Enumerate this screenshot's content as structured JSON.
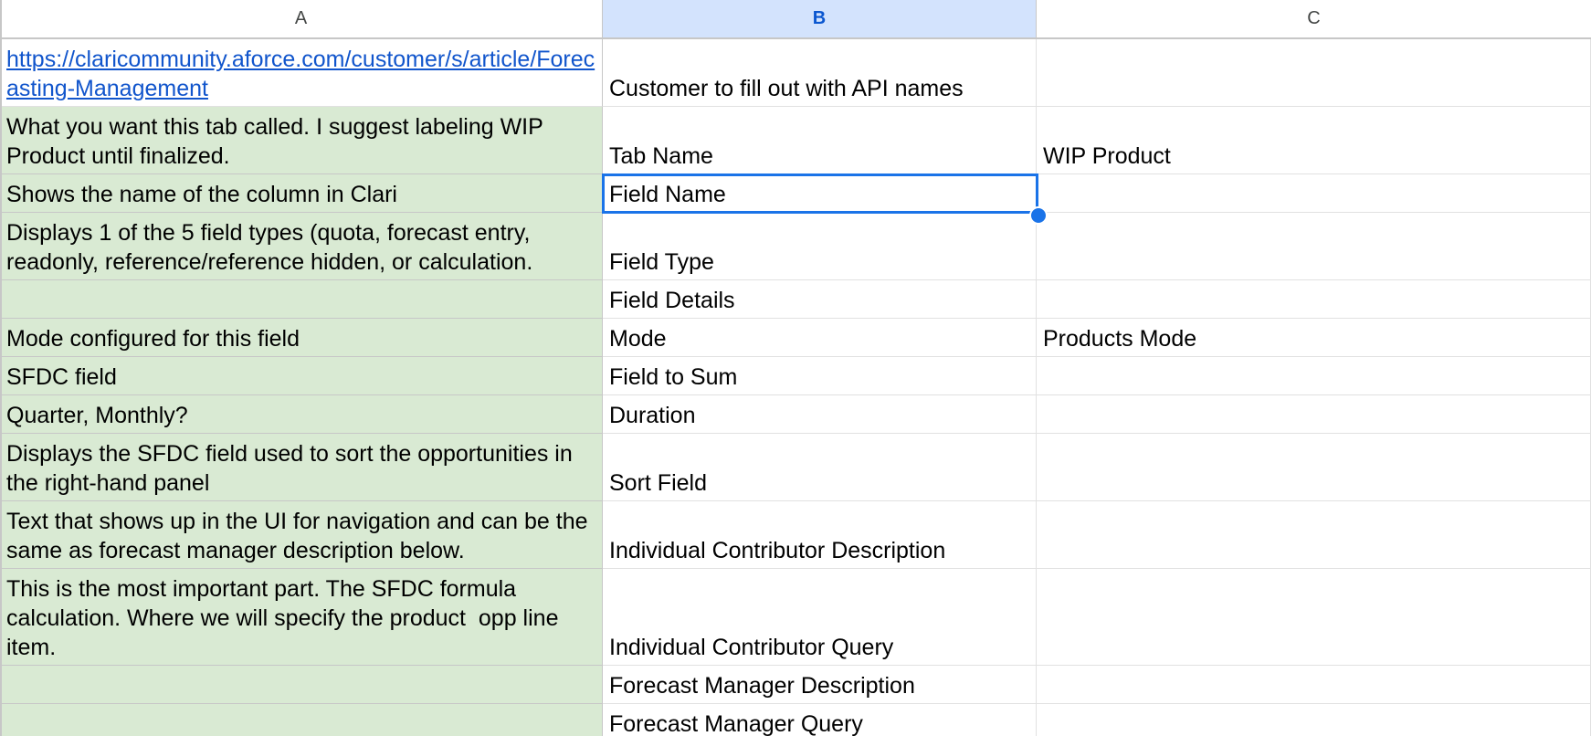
{
  "columns": [
    {
      "label": "A",
      "selected": false
    },
    {
      "label": "B",
      "selected": true
    },
    {
      "label": "C",
      "selected": false
    }
  ],
  "rows": [
    {
      "a": "https://claricommunity.aforce.com/customer/s/article/Forecasting-Management",
      "a_is_link": true,
      "b": "Customer to fill out with API names",
      "c": ""
    },
    {
      "a": "What you want this tab called. I suggest labeling WIP Product until finalized.",
      "b": "Tab Name",
      "c": "WIP Product"
    },
    {
      "a": "Shows the name of the column in Clari",
      "b": "Field Name",
      "c": ""
    },
    {
      "a": "Displays 1 of the 5 field types (quota, forecast entry, readonly, reference/reference hidden, or calculation.",
      "b": "Field Type",
      "c": ""
    },
    {
      "a": "",
      "b": "Field Details",
      "c": ""
    },
    {
      "a": "Mode configured for this field",
      "b": "Mode",
      "c": "Products Mode"
    },
    {
      "a": "SFDC field",
      "b": "Field to Sum",
      "c": ""
    },
    {
      "a": "Quarter, Monthly?",
      "b": "Duration",
      "c": ""
    },
    {
      "a": "Displays the SFDC field used to sort the opportunities in the right-hand panel",
      "b": "Sort Field",
      "c": ""
    },
    {
      "a": "Text that shows up in the UI for navigation and can be the same as forecast manager description below.",
      "b": "Individual Contributor Description",
      "c": ""
    },
    {
      "a": "This is the most important part. The SFDC formula calculation. Where we will specify the product  opp line item.",
      "b": "Individual Contributor Query",
      "c": ""
    },
    {
      "a": "",
      "b": "Forecast Manager Description",
      "c": ""
    },
    {
      "a": "",
      "b": "Forecast Manager Query",
      "c": ""
    }
  ],
  "selected_cell": "B3",
  "colors": {
    "description_fill": "#d9ead3",
    "selection": "#1a73e8",
    "selected_header": "#d3e3fd",
    "link": "#1155cc"
  }
}
